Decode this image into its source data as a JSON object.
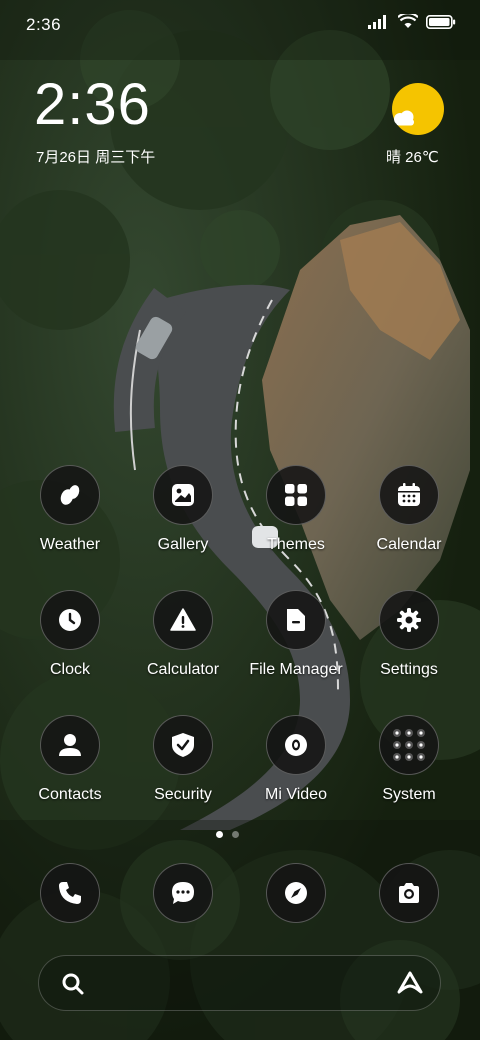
{
  "status_bar": {
    "time": "2:36",
    "icons": [
      "signal-icon",
      "wifi-icon",
      "battery-icon"
    ]
  },
  "clock_widget": {
    "time": "2:36",
    "date": "7月26日 周三下午"
  },
  "weather_widget": {
    "text": "晴 26℃",
    "icon": "sunny-cloud-icon"
  },
  "apps": [
    {
      "label": "Weather",
      "icon": "weather-drops-icon"
    },
    {
      "label": "Gallery",
      "icon": "gallery-icon"
    },
    {
      "label": "Themes",
      "icon": "themes-grid-icon"
    },
    {
      "label": "Calendar",
      "icon": "calendar-icon"
    },
    {
      "label": "Clock",
      "icon": "clock-icon"
    },
    {
      "label": "Calculator",
      "icon": "warning-triangle-icon"
    },
    {
      "label": "File Manager",
      "icon": "folder-icon"
    },
    {
      "label": "Settings",
      "icon": "gear-icon"
    },
    {
      "label": "Contacts",
      "icon": "person-icon"
    },
    {
      "label": "Security",
      "icon": "shield-check-icon"
    },
    {
      "label": "Mi Video",
      "icon": "video-icon"
    },
    {
      "label": "System",
      "icon": "app-folder-icon"
    }
  ],
  "page_indicator": {
    "current": 1,
    "total": 2
  },
  "dock": [
    {
      "name": "phone",
      "icon": "phone-icon"
    },
    {
      "name": "messages",
      "icon": "chat-bubble-icon"
    },
    {
      "name": "browser",
      "icon": "compass-icon"
    },
    {
      "name": "camera",
      "icon": "camera-icon"
    }
  ],
  "search_bar": {
    "left_icon": "search-icon",
    "right_icon": "assistant-icon"
  },
  "colors": {
    "sun": "#f5c400",
    "icon_bg": "#141414",
    "forest": "#1d2a1a",
    "road": "#4a4d4f"
  }
}
